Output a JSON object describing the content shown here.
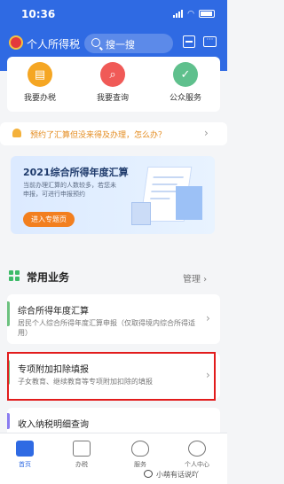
{
  "status": {
    "time": "10:36"
  },
  "header": {
    "title": "个人所得税",
    "search_placeholder": "搜一搜",
    "message_glyph": "···"
  },
  "quick_actions": [
    {
      "label": "我要办税",
      "icon": "tax-filing-icon",
      "color": "#f5a623"
    },
    {
      "label": "我要查询",
      "icon": "search-icon",
      "color": "#f05a57"
    },
    {
      "label": "公众服务",
      "icon": "public-service-icon",
      "color": "#5fc08d"
    }
  ],
  "notice": {
    "text": "预约了汇算但没来得及办理，怎么办？"
  },
  "banner": {
    "title": "2021综合所得年度汇算",
    "desc": "当前办理汇算的人数较多，若您未申报，可进行申报预约",
    "button": "进入专题页"
  },
  "section": {
    "title": "常用业务",
    "manage": "管理"
  },
  "business": [
    {
      "title": "综合所得年度汇算",
      "desc": "居民个人综合所得年度汇算申报（仅取得境内综合所得适用）"
    },
    {
      "title": "专项附加扣除填报",
      "desc": "子女教育、继续教育等专项附加扣除的填报"
    },
    {
      "title": "收入纳税明细查询",
      "desc": ""
    }
  ],
  "bottom_nav": [
    {
      "label": "首页",
      "active": true
    },
    {
      "label": "办税",
      "active": false
    },
    {
      "label": "服务",
      "active": false
    },
    {
      "label": "个人中心",
      "active": false
    }
  ],
  "watermark": {
    "text": "小萌有话说吖"
  },
  "colors": {
    "primary": "#2f6ae3",
    "warning": "#f4b13b",
    "highlight": "#e21c1c"
  }
}
